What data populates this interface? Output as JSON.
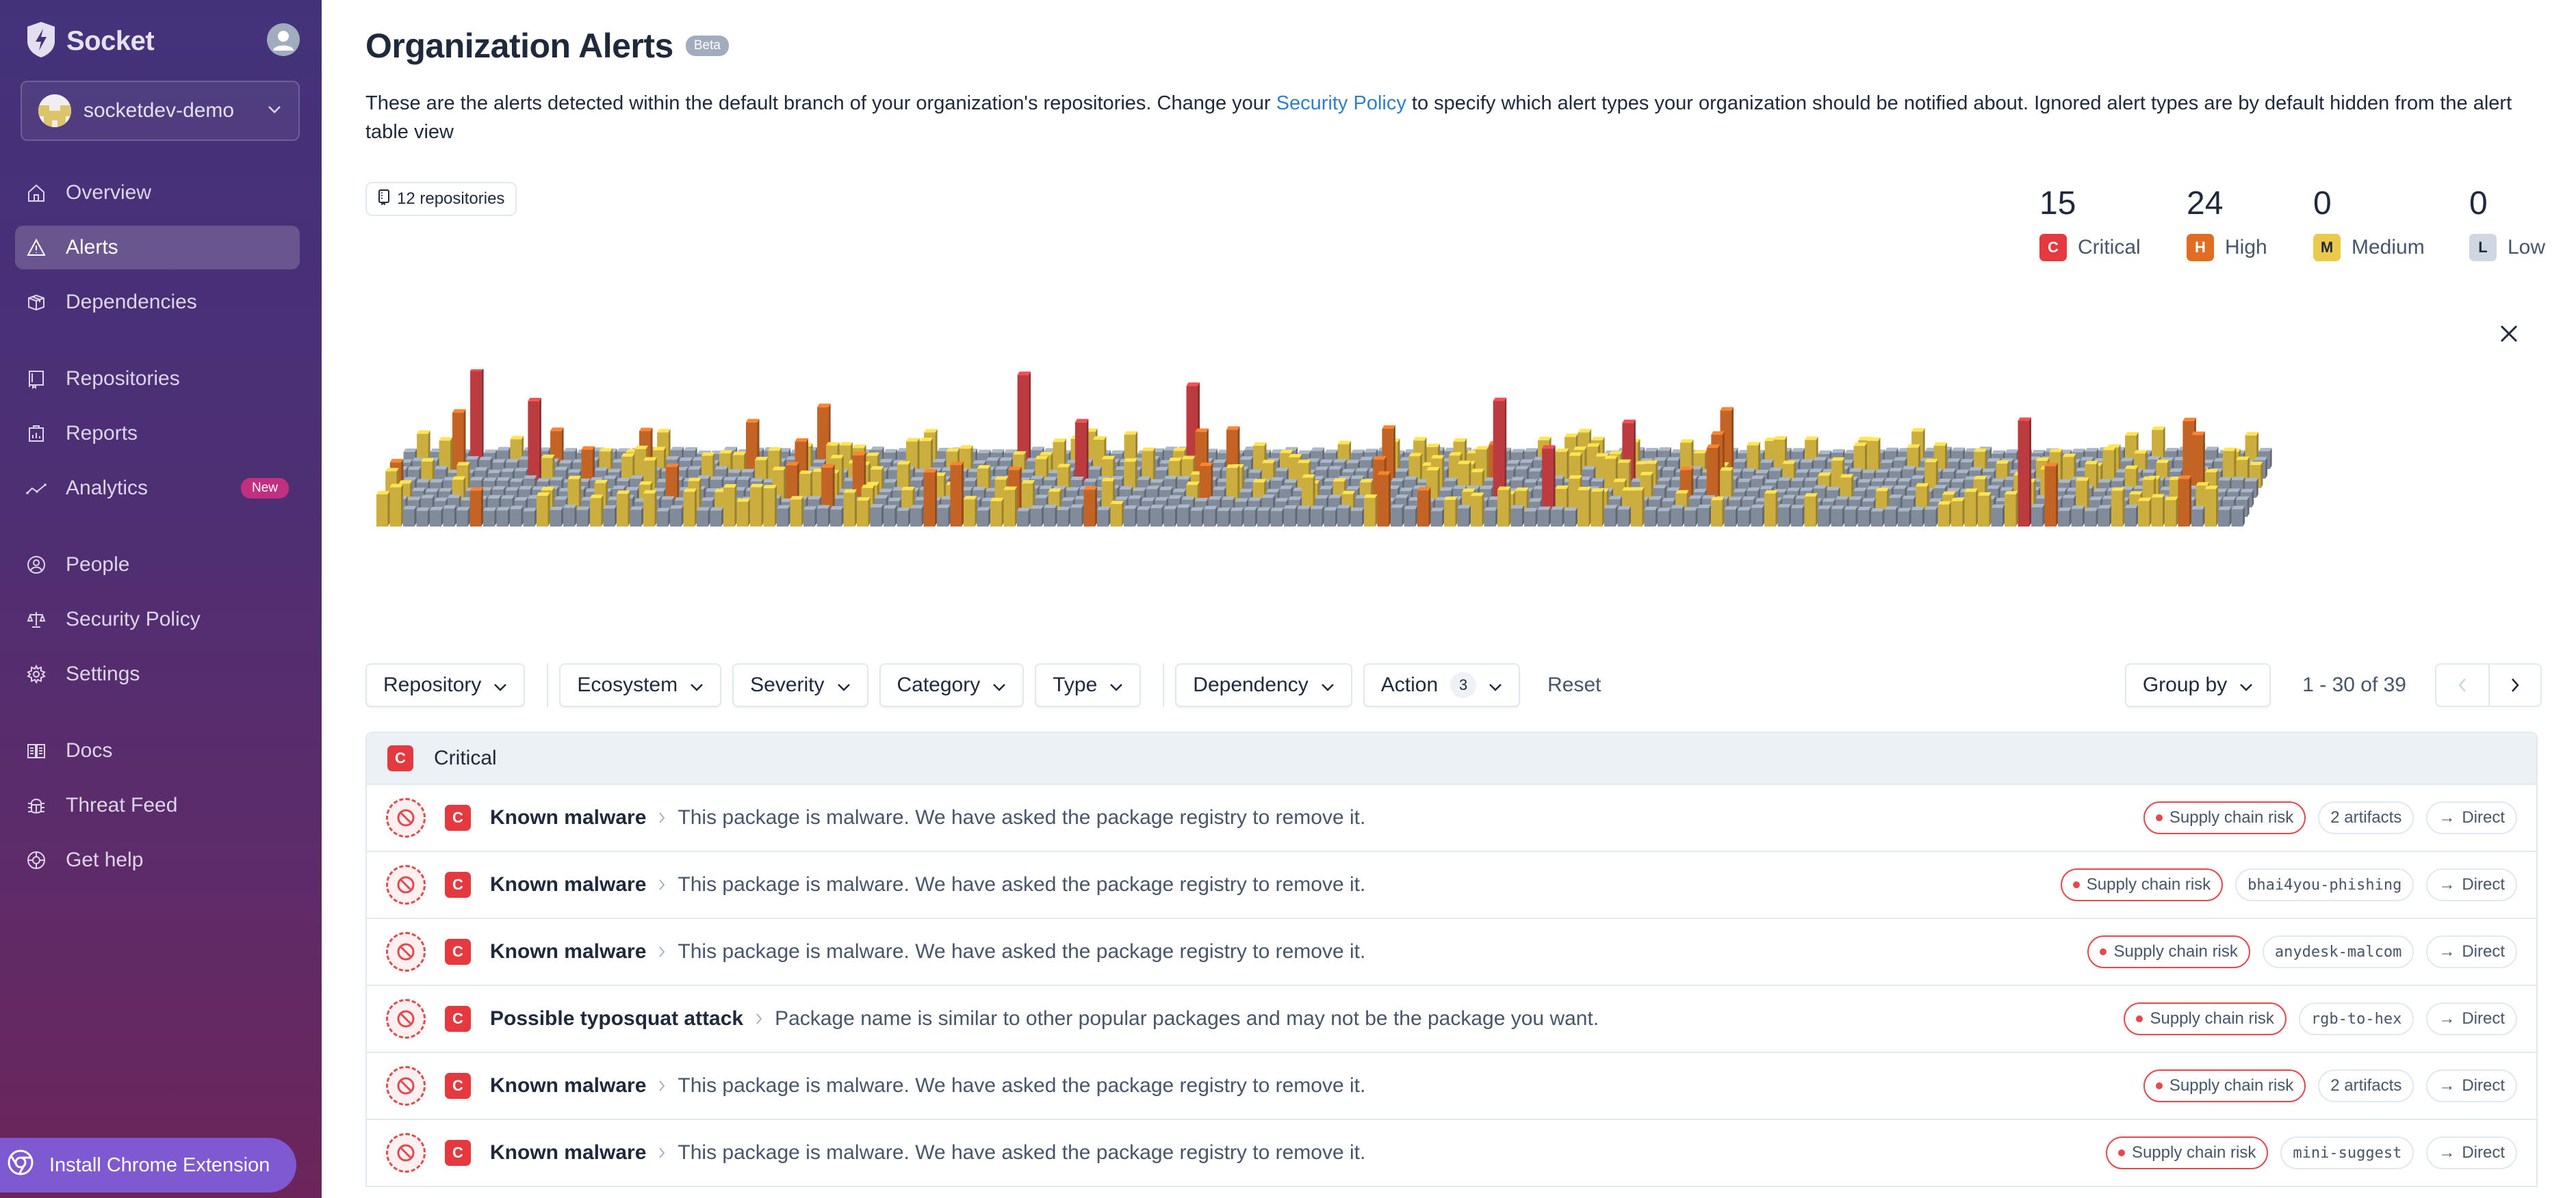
{
  "sidebar": {
    "brand": "Socket",
    "org": {
      "name": "socketdev-demo"
    },
    "nav_groups": [
      [
        {
          "label": "Overview",
          "icon": "home-icon",
          "active": false
        },
        {
          "label": "Alerts",
          "icon": "warning-icon",
          "active": true
        },
        {
          "label": "Dependencies",
          "icon": "package-icon",
          "active": false
        }
      ],
      [
        {
          "label": "Repositories",
          "icon": "repo-icon",
          "active": false
        },
        {
          "label": "Reports",
          "icon": "report-icon",
          "active": false
        },
        {
          "label": "Analytics",
          "icon": "analytics-icon",
          "active": false,
          "badge": "New"
        }
      ],
      [
        {
          "label": "People",
          "icon": "people-icon",
          "active": false
        },
        {
          "label": "Security Policy",
          "icon": "scale-icon",
          "active": false
        },
        {
          "label": "Settings",
          "icon": "gear-icon",
          "active": false
        }
      ],
      [
        {
          "label": "Docs",
          "icon": "book-icon",
          "active": false
        },
        {
          "label": "Threat Feed",
          "icon": "bug-icon",
          "active": false
        },
        {
          "label": "Get help",
          "icon": "lifebuoy-icon",
          "active": false
        }
      ]
    ],
    "chrome_extension_label": "Install Chrome Extension"
  },
  "header": {
    "title": "Organization Alerts",
    "badge": "Beta",
    "description_before": "These are the alerts detected within the default branch of your organization's repositories. Change your ",
    "description_link": "Security Policy",
    "description_after": " to specify which alert types your organization should be notified about. Ignored alert types are by default hidden from the alert table view",
    "repositories_label": "12 repositories"
  },
  "severity_counts": [
    {
      "count": "15",
      "letter": "C",
      "label": "Critical",
      "color": "#e5393f",
      "text_color": "#ffffff"
    },
    {
      "count": "24",
      "letter": "H",
      "label": "High",
      "color": "#e06d22",
      "text_color": "#ffffff"
    },
    {
      "count": "0",
      "letter": "M",
      "label": "Medium",
      "color": "#ecc94b",
      "text_color": "#1e293b"
    },
    {
      "count": "0",
      "letter": "L",
      "label": "Low",
      "color": "#cfd8e2",
      "text_color": "#1e293b"
    }
  ],
  "visualization": {
    "colors": {
      "none": "#9eaabb",
      "medium": "#f7d44c",
      "high": "#ee7a2c",
      "critical": "#e5484d"
    }
  },
  "filters": {
    "groups": [
      [
        "Repository"
      ],
      [
        "Ecosystem",
        "Severity",
        "Category",
        "Type"
      ],
      [
        "Dependency",
        "Action"
      ]
    ],
    "action_count": "3",
    "reset_label": "Reset",
    "group_by_label": "Group by",
    "pagination": "1 - 30 of 39"
  },
  "table": {
    "group": {
      "letter": "C",
      "label": "Critical"
    },
    "rows": [
      {
        "severity": "C",
        "name": "Known malware",
        "description": "This package is malware. We have asked the package registry to remove it.",
        "category": "Supply chain risk",
        "package": "2 artifacts",
        "package_mono": false,
        "dependency": "Direct"
      },
      {
        "severity": "C",
        "name": "Known malware",
        "description": "This package is malware. We have asked the package registry to remove it.",
        "category": "Supply chain risk",
        "package": "bhai4you-phishing",
        "package_mono": true,
        "dependency": "Direct"
      },
      {
        "severity": "C",
        "name": "Known malware",
        "description": "This package is malware. We have asked the package registry to remove it.",
        "category": "Supply chain risk",
        "package": "anydesk-malcom",
        "package_mono": true,
        "dependency": "Direct"
      },
      {
        "severity": "C",
        "name": "Possible typosquat attack",
        "description": "Package name is similar to other popular packages and may not be the package you want.",
        "category": "Supply chain risk",
        "package": "rgb-to-hex",
        "package_mono": true,
        "dependency": "Direct"
      },
      {
        "severity": "C",
        "name": "Known malware",
        "description": "This package is malware. We have asked the package registry to remove it.",
        "category": "Supply chain risk",
        "package": "2 artifacts",
        "package_mono": false,
        "dependency": "Direct"
      },
      {
        "severity": "C",
        "name": "Known malware",
        "description": "This package is malware. We have asked the package registry to remove it.",
        "category": "Supply chain risk",
        "package": "mini-suggest",
        "package_mono": true,
        "dependency": "Direct"
      }
    ]
  }
}
